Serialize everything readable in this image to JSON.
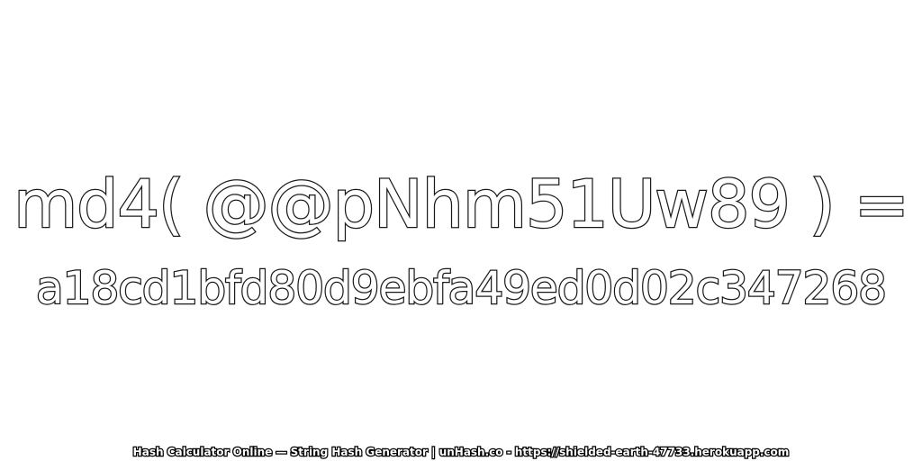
{
  "image": {
    "input_expression": "md4( @@pNhm51Uw89 ) =",
    "hash_value": "a18cd1bfd80d9ebfa49ed0d02c347268",
    "footer_text": "Hash Calculator Online — String Hash Generator | unHash.co - https://shielded-earth-47733.herokuapp.com"
  },
  "colors": {
    "background": "#ffffff",
    "text_fill": "#ffffff",
    "text_outline": "#1a1a1a"
  }
}
